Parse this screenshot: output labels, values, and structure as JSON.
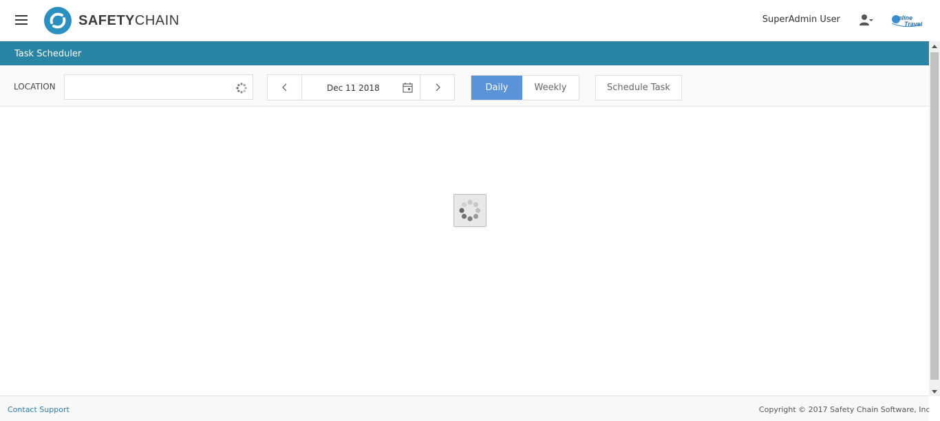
{
  "header": {
    "menu_icon": "hamburger-icon",
    "logo": {
      "bold": "SAFETY",
      "regular": "CHAIN"
    },
    "user_name": "SuperAdmin User",
    "user_icon": "user-settings-icon",
    "brand_icon": "online-travel-logo"
  },
  "titlebar": {
    "title": "Task Scheduler"
  },
  "toolbar": {
    "location_label": "LOCATION",
    "location_value": "",
    "date": "Dec 11 2018",
    "view_options": [
      "Daily",
      "Weekly"
    ],
    "selected_view": "Daily",
    "schedule_button": "Schedule Task"
  },
  "footer": {
    "contact_link": "Contact Support",
    "copyright": "Copyright © 2017 Safety Chain Software, Inc."
  },
  "colors": {
    "titlebar": "#2a84a3",
    "active_view": "#5b93d8",
    "link": "#2a7bb5"
  }
}
